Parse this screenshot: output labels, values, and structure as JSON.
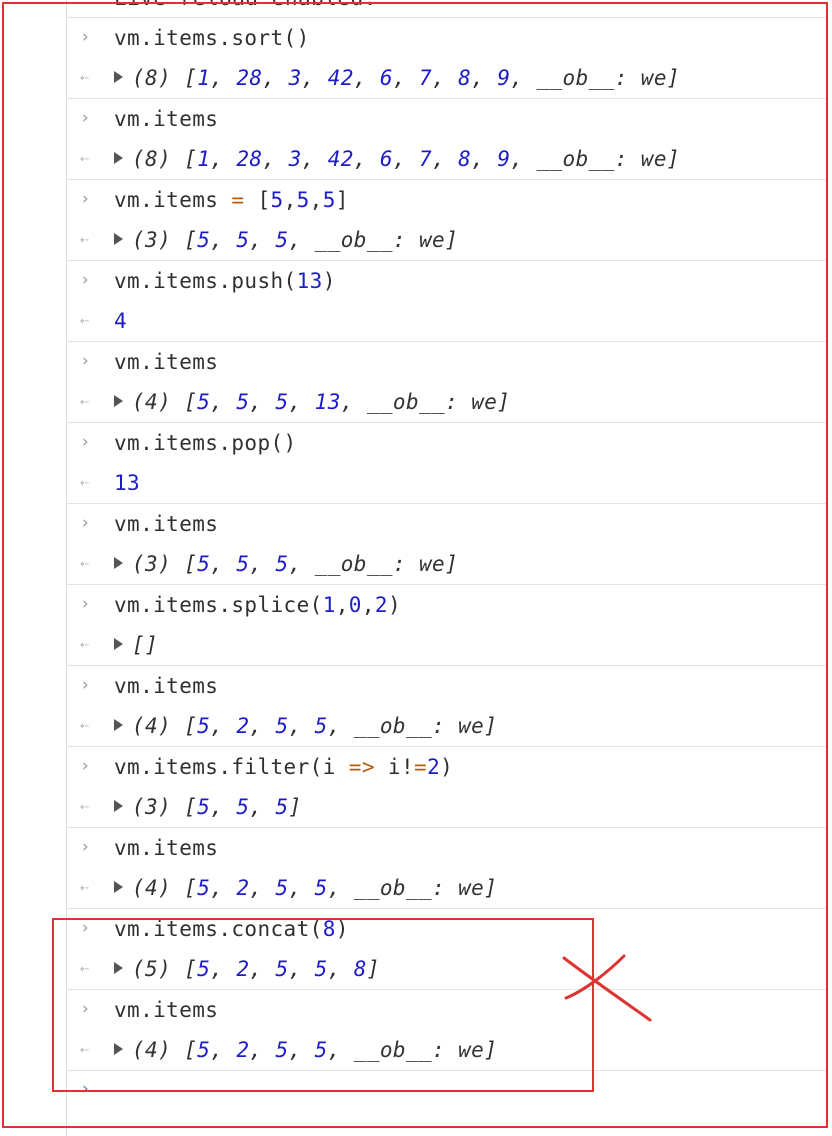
{
  "top_partial_text": "Live reload enabled.",
  "entries": [
    {
      "input": "vm.items.sort()",
      "result": {
        "count": "(8)",
        "values": [
          "1",
          "28",
          "3",
          "42",
          "6",
          "7",
          "8",
          "9"
        ],
        "tail": "__ob__: we"
      }
    },
    {
      "input": "vm.items",
      "result": {
        "count": "(8)",
        "values": [
          "1",
          "28",
          "3",
          "42",
          "6",
          "7",
          "8",
          "9"
        ],
        "tail": "__ob__: we"
      }
    },
    {
      "input": "vm.items = [5,5,5]",
      "result": {
        "count": "(3)",
        "values": [
          "5",
          "5",
          "5"
        ],
        "tail": "__ob__: we"
      }
    },
    {
      "input": "vm.items.push(13)",
      "result_plain": "4"
    },
    {
      "input": "vm.items",
      "result": {
        "count": "(4)",
        "values": [
          "5",
          "5",
          "5",
          "13"
        ],
        "tail": "__ob__: we"
      }
    },
    {
      "input": "vm.items.pop()",
      "result_plain": "13"
    },
    {
      "input": "vm.items",
      "result": {
        "count": "(3)",
        "values": [
          "5",
          "5",
          "5"
        ],
        "tail": "__ob__: we"
      }
    },
    {
      "input": "vm.items.splice(1,0,2)",
      "result": {
        "count": "",
        "values": [],
        "tail": ""
      }
    },
    {
      "input": "vm.items",
      "result": {
        "count": "(4)",
        "values": [
          "5",
          "2",
          "5",
          "5"
        ],
        "tail": "__ob__: we"
      }
    },
    {
      "input": "vm.items.filter(i => i!=2)",
      "result": {
        "count": "(3)",
        "values": [
          "5",
          "5",
          "5"
        ],
        "tail": ""
      }
    },
    {
      "input": "vm.items",
      "result": {
        "count": "(4)",
        "values": [
          "5",
          "2",
          "5",
          "5"
        ],
        "tail": "__ob__: we"
      }
    },
    {
      "input": "vm.items.concat(8)",
      "result": {
        "count": "(5)",
        "values": [
          "5",
          "2",
          "5",
          "5",
          "8"
        ],
        "tail": ""
      }
    },
    {
      "input": "vm.items",
      "result": {
        "count": "(4)",
        "values": [
          "5",
          "2",
          "5",
          "5"
        ],
        "tail": "__ob__: we"
      }
    }
  ],
  "icons": {
    "prompt": "chevron-right-icon",
    "result": "return-arrow-icon",
    "expand": "expand-triangle-icon"
  },
  "colors": {
    "number": "#1c1cc8",
    "operator": "#b85c10",
    "annotation": "#dd3333"
  }
}
